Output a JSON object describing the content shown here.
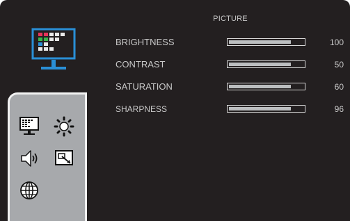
{
  "menu": {
    "title": "PICTURE"
  },
  "settings": [
    {
      "label": "BRIGHTNESS",
      "value": "100",
      "level": 0.82
    },
    {
      "label": "CONTRAST",
      "value": "50",
      "level": 0.82
    },
    {
      "label": "SATURATION",
      "value": "60",
      "level": 0.82
    },
    {
      "label": "SHARPNESS",
      "value": "96",
      "level": 0.82
    }
  ],
  "sidebar": {
    "items": [
      {
        "icon": "picture-monitor-icon",
        "selected": true
      },
      {
        "icon": "brightness-sun-icon",
        "selected": false
      },
      {
        "icon": "speaker-sound-icon",
        "selected": false
      },
      {
        "icon": "screen-resize-icon",
        "selected": false
      },
      {
        "icon": "globe-language-icon",
        "selected": false
      }
    ]
  },
  "colors": {
    "background": "#231f20",
    "text": "#c8c8c8",
    "panel": "#a7a9ac",
    "bar_fill": "#bcbec0",
    "monitor_blue": "#2a8fd6"
  }
}
